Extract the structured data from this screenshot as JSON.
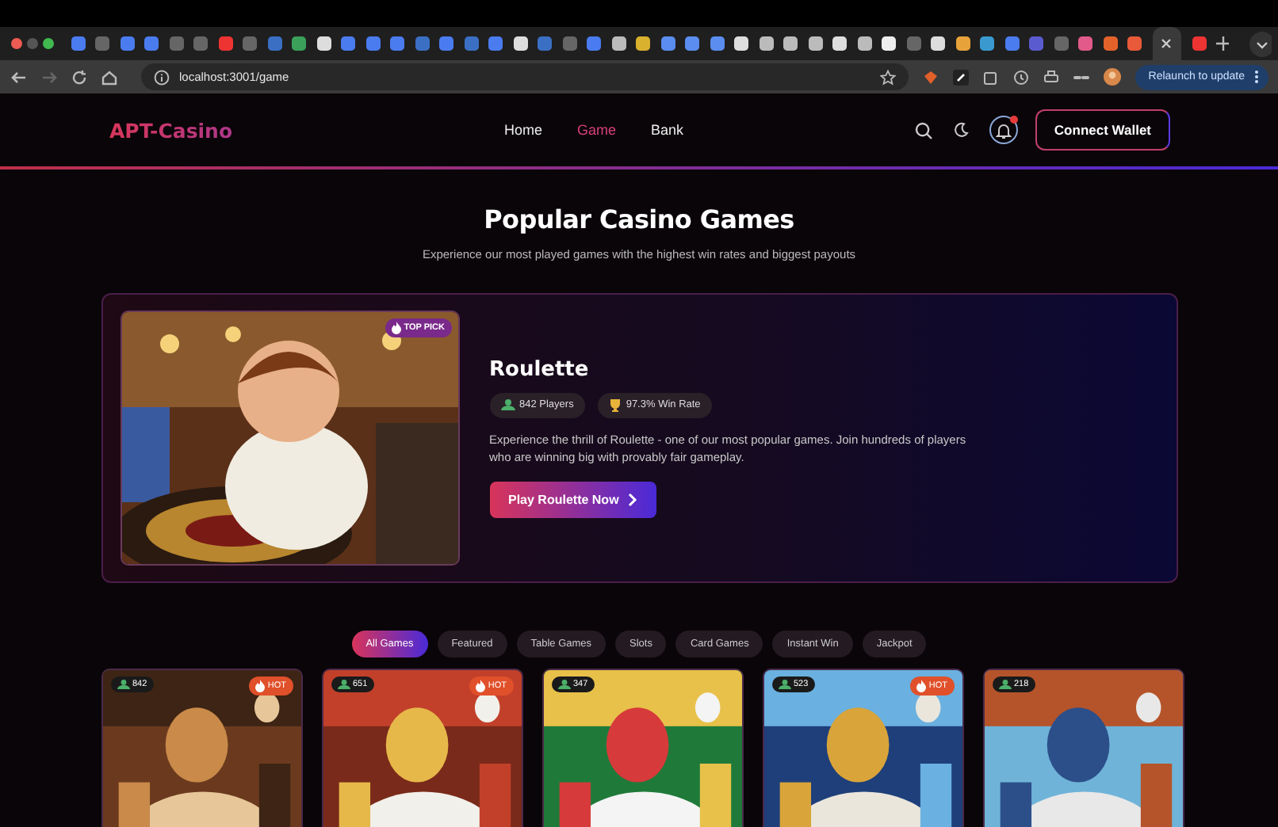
{
  "browser": {
    "address": "localhost:3001/game",
    "update_button": "Relaunch to update"
  },
  "nav": {
    "logo": "APT-Casino",
    "links": [
      {
        "label": "Home",
        "selected": false
      },
      {
        "label": "Game",
        "selected": true
      },
      {
        "label": "Bank",
        "selected": false
      }
    ],
    "notification": true,
    "connect_button": "Connect Wallet"
  },
  "hero": {
    "title": "Popular Casino Games",
    "subtitle": "Experience our most played games with the highest win rates and biggest payouts"
  },
  "featured": {
    "badge": "TOP PICK",
    "title": "Roulette",
    "stats": [
      {
        "kind": "players",
        "text": "842 Players"
      },
      {
        "kind": "trophy",
        "text": "97.3% Win Rate"
      }
    ],
    "description": "Experience the thrill of Roulette - one of our most popular games. Join hundreds of players who are winning big with provably fair gameplay.",
    "button": "Play Roulette Now"
  },
  "filters": [
    {
      "label": "All Games",
      "selected": true
    },
    {
      "label": "Featured",
      "selected": false
    },
    {
      "label": "Table Games",
      "selected": false
    },
    {
      "label": "Slots",
      "selected": false
    },
    {
      "label": "Card Games",
      "selected": false
    },
    {
      "label": "Instant Win",
      "selected": false
    },
    {
      "label": "Jackpot",
      "selected": false
    }
  ],
  "games": [
    {
      "players": "842",
      "hot": true,
      "hot_label": "HOT"
    },
    {
      "players": "651",
      "hot": true,
      "hot_label": "HOT"
    },
    {
      "players": "347",
      "hot": false
    },
    {
      "players": "523",
      "hot": true,
      "hot_label": "HOT"
    },
    {
      "players": "218",
      "hot": false
    }
  ]
}
